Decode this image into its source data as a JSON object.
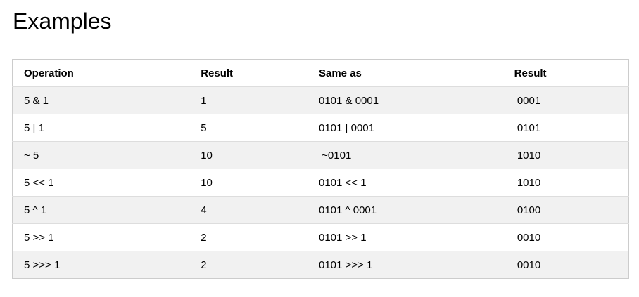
{
  "heading": "Examples",
  "table": {
    "headers": [
      "Operation",
      "Result",
      "Same as",
      "Result"
    ],
    "rows": [
      [
        "5 & 1",
        "1",
        "0101 & 0001",
        " 0001"
      ],
      [
        "5 | 1",
        "5",
        "0101 | 0001",
        " 0101"
      ],
      [
        "~ 5",
        "10",
        " ~0101",
        " 1010"
      ],
      [
        "5 << 1",
        "10",
        "0101 << 1",
        " 1010"
      ],
      [
        "5 ^ 1",
        "4",
        "0101 ^ 0001",
        " 0100"
      ],
      [
        "5 >> 1",
        "2",
        "0101 >> 1",
        " 0010"
      ],
      [
        "5 >>> 1",
        "2",
        "0101 >>> 1",
        " 0010"
      ]
    ]
  }
}
